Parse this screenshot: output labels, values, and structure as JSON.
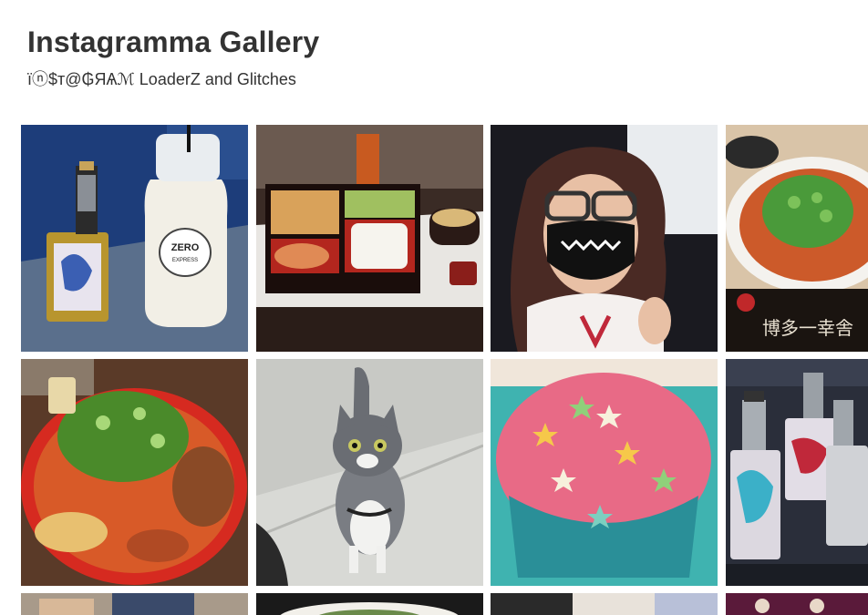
{
  "gallery": {
    "title": "Instagramma Gallery",
    "subtitle": "ïⓝ$т@₲ЯѦℳ LoaderZ and Glitches"
  },
  "photos": [
    {
      "subject": "vape mod and Zero Express milk bottle",
      "bottle_label": "ZERO EXPRESS"
    },
    {
      "subject": "bento box with rice, salmon and miso soup"
    },
    {
      "subject": "person with glasses and smiling face mask"
    },
    {
      "subject": "tonkotsu ramen with green onions",
      "sign_text": "博多一幸舎"
    },
    {
      "subject": "spicy ramen in red bowl"
    },
    {
      "subject": "grey and white kitten on sidewalk"
    },
    {
      "subject": "pink frosted cupcake with star sprinkles"
    },
    {
      "subject": "vape mods with anime wraps"
    },
    {
      "subject": "partial photo"
    },
    {
      "subject": "partial photo"
    },
    {
      "subject": "partial photo"
    },
    {
      "subject": "partial photo"
    }
  ],
  "colors": {
    "text": "#333333",
    "background": "#ffffff"
  }
}
